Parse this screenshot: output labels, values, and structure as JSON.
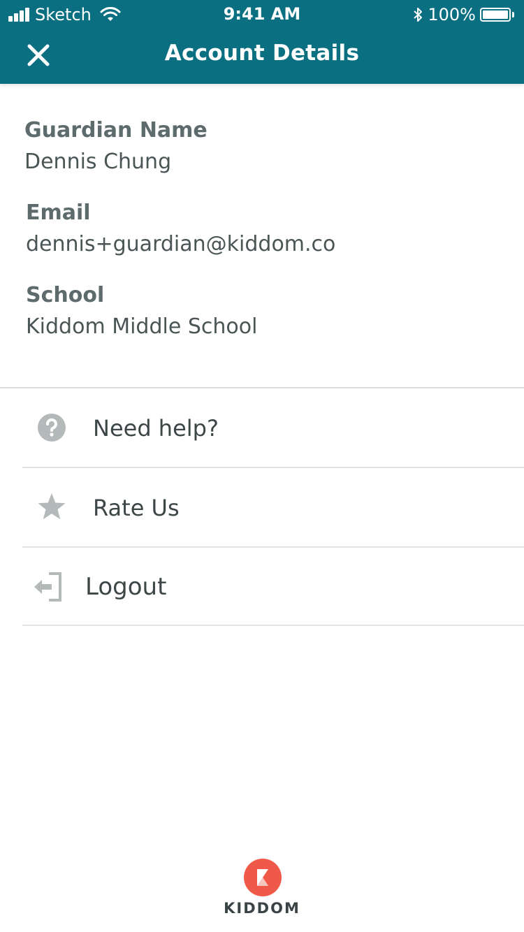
{
  "status_bar": {
    "carrier": "Sketch",
    "time": "9:41 AM",
    "battery": "100%"
  },
  "header": {
    "title": "Account Details",
    "close_icon": "close-icon",
    "background": "#0b6f82"
  },
  "account": {
    "guardian_name_label": "Guardian Name",
    "guardian_name": "Dennis Chung",
    "email_label": "Email",
    "email": "dennis+guardian@kiddom.co",
    "school_label": "School",
    "school": "Kiddom Middle School"
  },
  "menu": {
    "items": [
      {
        "label": "Need help?",
        "icon": "help-icon"
      },
      {
        "label": "Rate Us",
        "icon": "star-icon"
      },
      {
        "label": "Logout",
        "icon": "logout-icon"
      }
    ]
  },
  "footer": {
    "brand": "KIDDOM",
    "logo_color": "#f0594a"
  }
}
